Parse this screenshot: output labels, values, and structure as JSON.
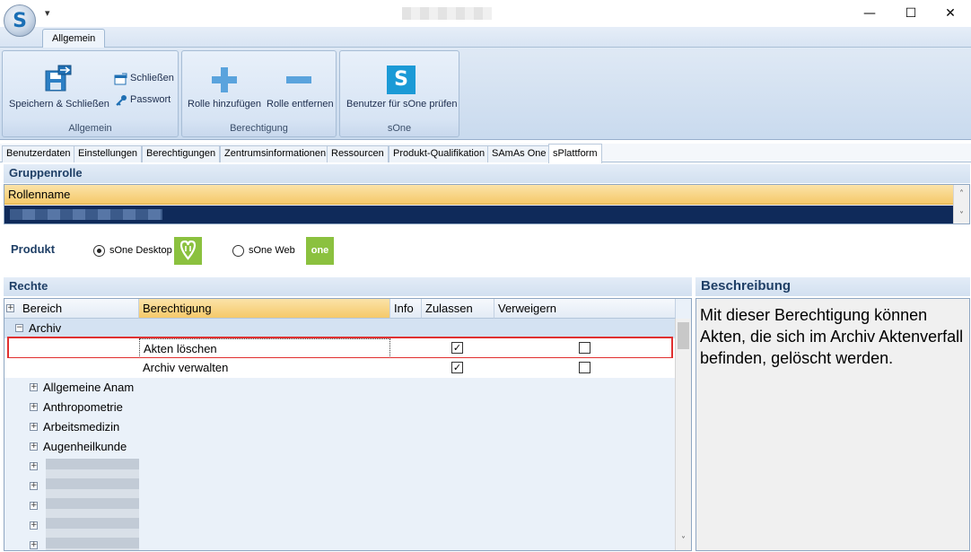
{
  "app": {
    "logo_letter": "S",
    "qat_glyph": "▾",
    "window_controls": [
      "—",
      "☐",
      "✕"
    ]
  },
  "ribbon": {
    "tab_label": "Allgemein",
    "groups": [
      {
        "label": "Allgemein",
        "buttons": {
          "save_close": "Speichern & Schließen",
          "close": "Schließen",
          "password": "Passwort"
        }
      },
      {
        "label": "Berechtigung",
        "buttons": {
          "add_role": "Rolle hinzufügen",
          "remove_role": "Rolle entfernen"
        }
      },
      {
        "label": "sOne",
        "buttons": {
          "check_users": "Benutzer für sOne prüfen",
          "icon_letter": "S"
        }
      }
    ]
  },
  "tabs": [
    "Benutzerdaten",
    "Einstellungen",
    "Berechtigungen",
    "Zentrumsinformationen",
    "Ressourcen",
    "Produkt-Qualifikation",
    "SAmAs One",
    "sPlattform"
  ],
  "active_tab": "sPlattform",
  "gruppenrolle": {
    "title": "Gruppenrolle",
    "column": "Rollenname"
  },
  "produkt": {
    "label": "Produkt",
    "options": [
      {
        "label": "sOne Desktop",
        "selected": true,
        "logo_color": "#8bc13f"
      },
      {
        "label": "sOne Web",
        "selected": false,
        "logo_color": "#8bc13f",
        "logo_text": "one"
      }
    ]
  },
  "rechte": {
    "title": "Rechte",
    "columns": [
      "Bereich",
      "Berechtigung",
      "Info",
      "Zulassen",
      "Verweigern"
    ],
    "group_open": "Archiv",
    "rows": [
      {
        "berechtigung": "Akten löschen",
        "zulassen": true,
        "verweigern": false,
        "highlighted": true
      },
      {
        "berechtigung": "Archiv verwalten",
        "zulassen": true,
        "verweigern": false,
        "highlighted": false
      }
    ],
    "collapsed_groups": [
      "Allgemeine Anam",
      "Anthropometrie",
      "Arbeitsmedizin",
      "Augenheilkunde"
    ]
  },
  "beschreibung": {
    "title": "Beschreibung",
    "text": "Mit dieser Berechtigung können Akten, die sich im Archiv Aktenverfall befinden, gelöscht werden."
  },
  "glyphs": {
    "check": "✓",
    "expand": "+",
    "collapse": "−",
    "up": "˄",
    "down": "˅"
  }
}
